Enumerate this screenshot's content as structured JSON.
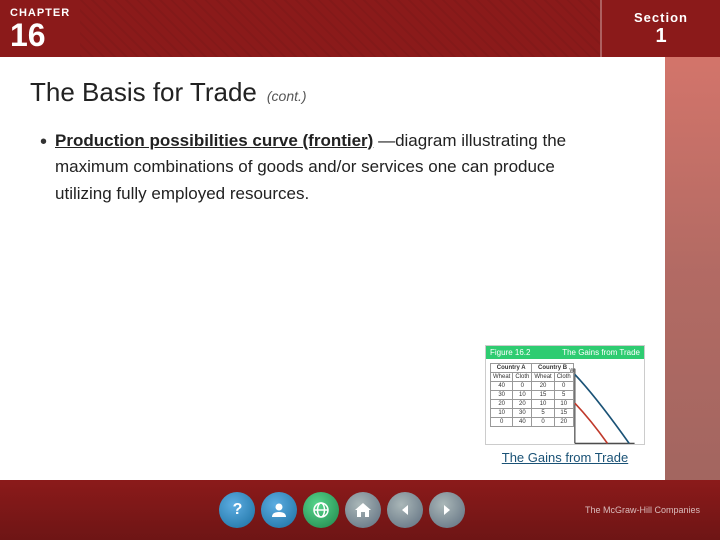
{
  "header": {
    "chapter_label": "CHAPTER",
    "chapter_number": "16",
    "section_label": "Section",
    "section_number": "1"
  },
  "page": {
    "title": "The Basis for Trade",
    "title_cont": "(cont.)",
    "bullet": {
      "term": "Production possibilities curve (frontier)",
      "description": "—diagram illustrating the maximum combinations of goods and/or services one can produce utilizing fully employed resources."
    }
  },
  "figure": {
    "link_text": "The Gains from Trade",
    "header_left": "Figure 16.2",
    "header_right": "The Gains from Trade"
  },
  "nav": {
    "icons": [
      {
        "name": "question",
        "symbol": "?",
        "color": "blue"
      },
      {
        "name": "person",
        "symbol": "👤",
        "color": "blue"
      },
      {
        "name": "globe",
        "symbol": "🌐",
        "color": "green"
      },
      {
        "name": "home",
        "symbol": "⌂",
        "color": "gray"
      },
      {
        "name": "prev",
        "symbol": "◀",
        "color": "gray"
      },
      {
        "name": "next",
        "symbol": "▶",
        "color": "gray"
      }
    ]
  },
  "branding": {
    "logo": "The McGraw-Hill Companies"
  }
}
